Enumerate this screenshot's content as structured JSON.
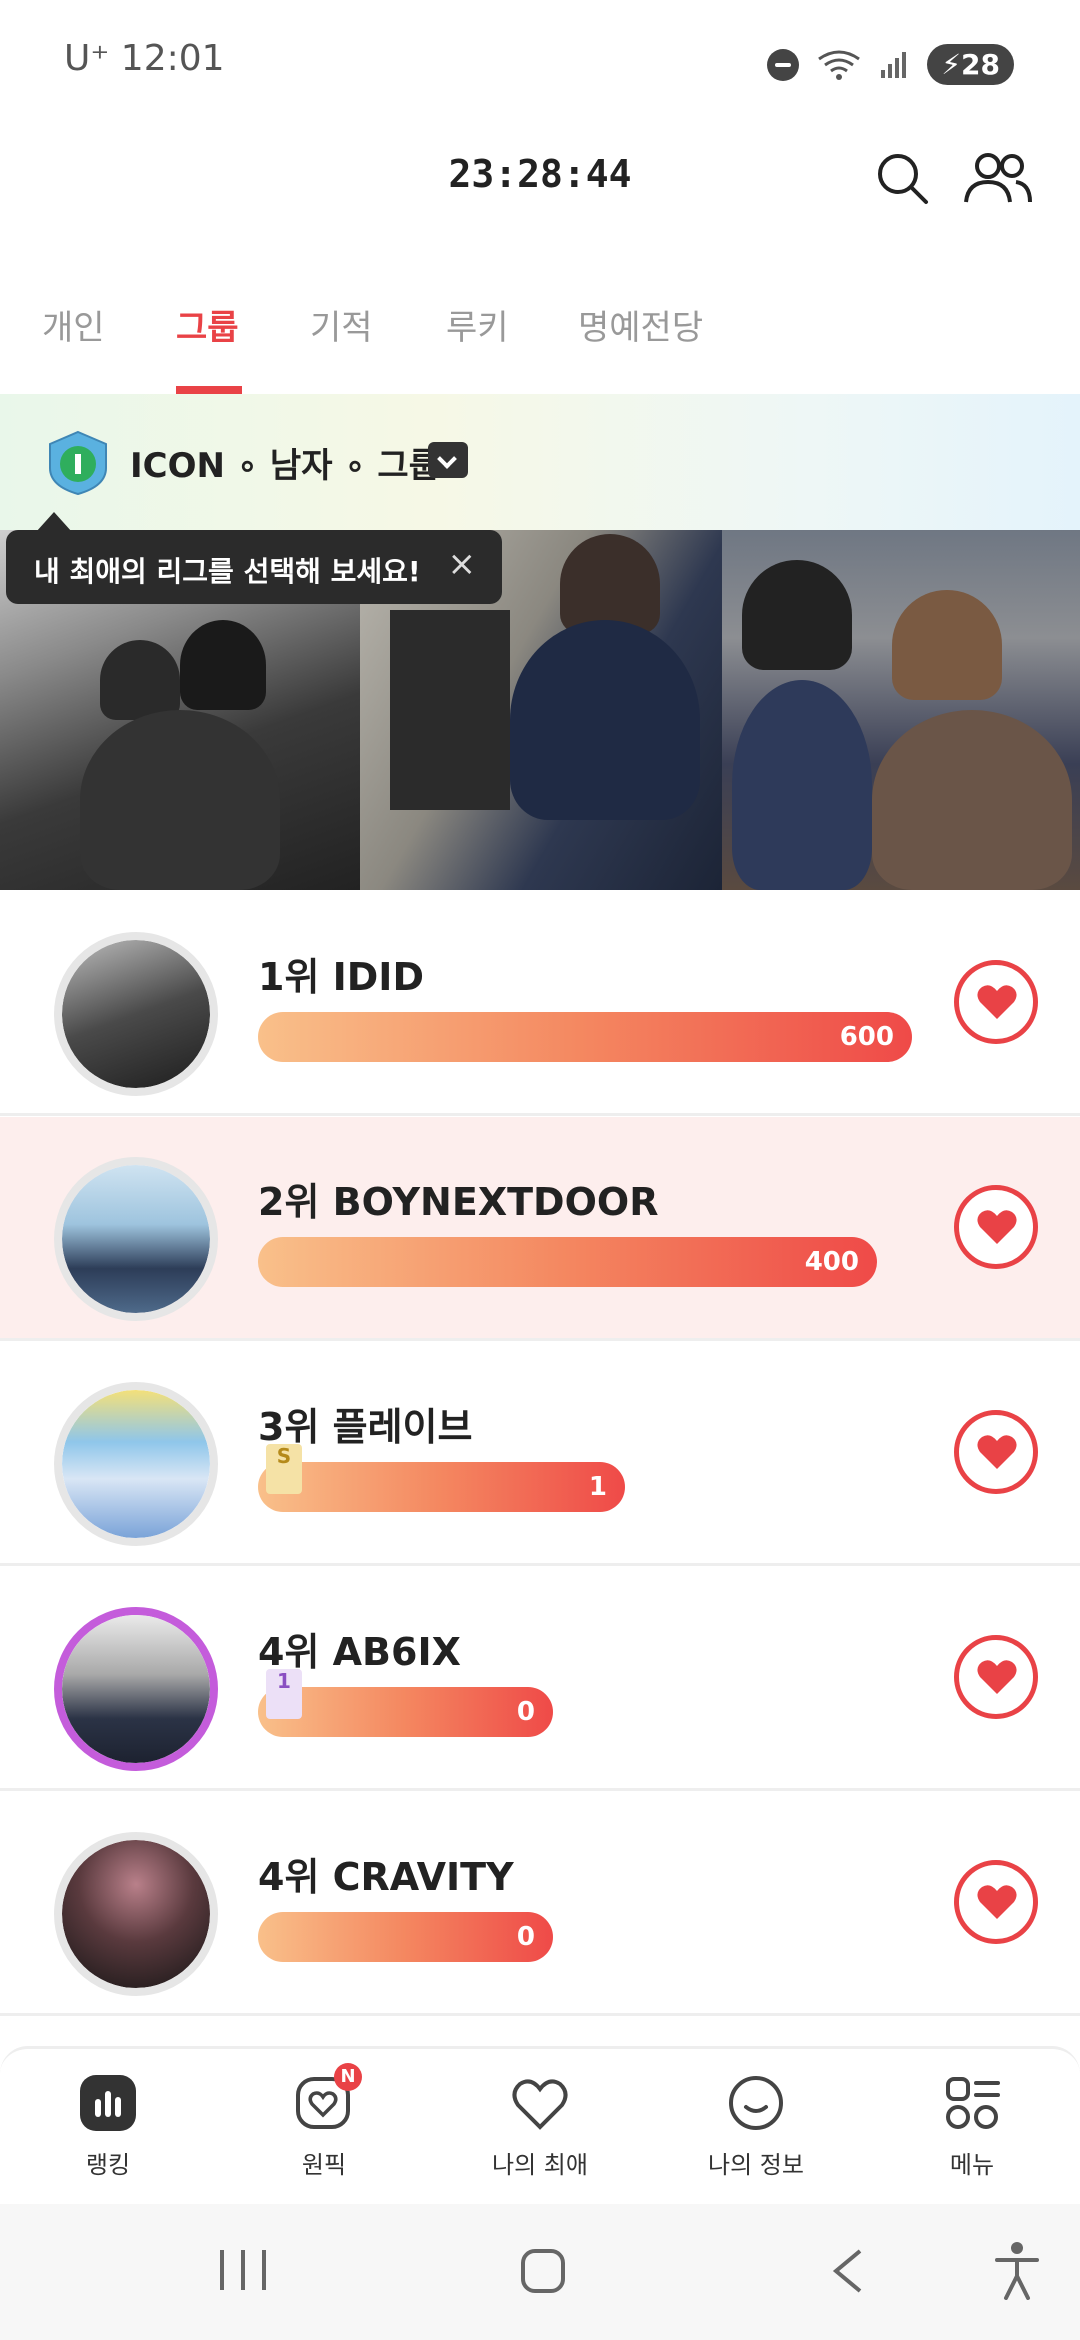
{
  "status_bar": {
    "carrier_time": "U⁺ 12:01",
    "battery": "28"
  },
  "header": {
    "clock": "23:28:44"
  },
  "tabs": [
    {
      "label": "개인",
      "active": false
    },
    {
      "label": "그룹",
      "active": true
    },
    {
      "label": "기적",
      "active": false
    },
    {
      "label": "루키",
      "active": false
    },
    {
      "label": "명예전당",
      "active": false
    }
  ],
  "league": {
    "label": "ICON ∘ 남자 ∘ 그룹"
  },
  "tooltip": {
    "text": "내 최애의 리그를 선택해 보세요!",
    "close": "×"
  },
  "ranking": [
    {
      "title": "1위 IDID",
      "value": "600",
      "ratio": 1.0,
      "highlight": false
    },
    {
      "title": "2위 BOYNEXTDOOR",
      "value": "400",
      "ratio": 0.947,
      "highlight": true
    },
    {
      "title": "3위 플레이브",
      "value": "1",
      "ratio": 0.561,
      "highlight": false,
      "badge": "S"
    },
    {
      "title": "4위 AB6IX",
      "value": "0",
      "ratio": 0.451,
      "highlight": false,
      "badge": "1"
    },
    {
      "title": "4위 CRAVITY",
      "value": "0",
      "ratio": 0.451,
      "highlight": false
    }
  ],
  "bottom_nav": [
    {
      "label": "랭킹",
      "icon": "ranking-icon",
      "active": true
    },
    {
      "label": "원픽",
      "icon": "onepick-icon",
      "badge": "N"
    },
    {
      "label": "나의 최애",
      "icon": "heart-outline-icon"
    },
    {
      "label": "나의 정보",
      "icon": "smile-icon"
    },
    {
      "label": "메뉴",
      "icon": "menu-grid-icon"
    }
  ],
  "colors": {
    "accent": "#e94246",
    "highlight_row": "#fdeeed"
  }
}
